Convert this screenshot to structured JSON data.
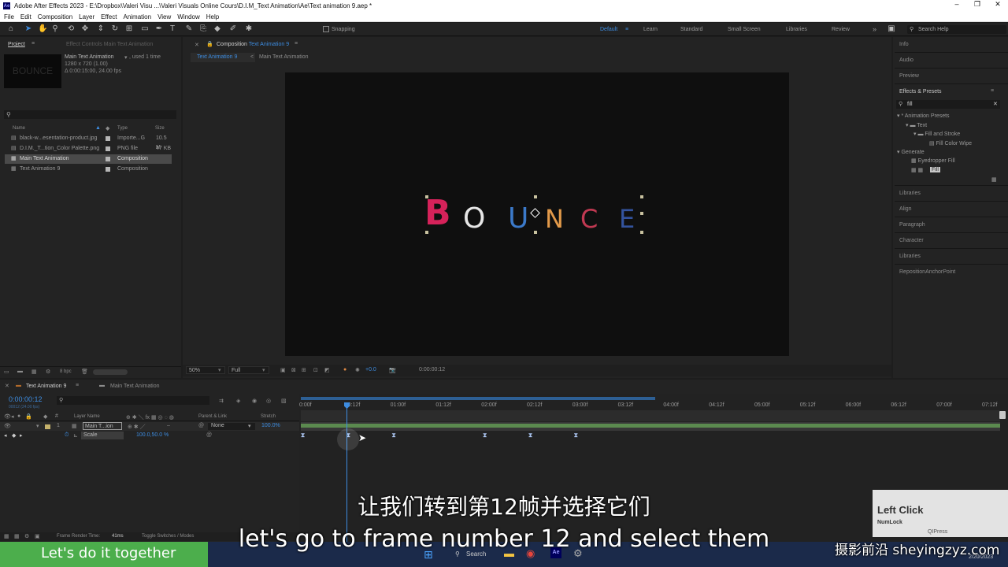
{
  "window": {
    "title": "Adobe After Effects 2023 - E:\\Dropbox\\Valeri Visu ...\\Valeri Visuals Online Cours\\D.I.M_Text Animation\\Ae\\Text animation 9.aep *",
    "app_icon": "Ae",
    "minimize": "–",
    "maximize": "❐",
    "close": "✕"
  },
  "menu": [
    "File",
    "Edit",
    "Composition",
    "Layer",
    "Effect",
    "Animation",
    "View",
    "Window",
    "Help"
  ],
  "toolbar": {
    "snapping": "Snapping",
    "workspaces": [
      "Default",
      "Learn",
      "Standard",
      "Small Screen",
      "Libraries",
      "Review"
    ],
    "more": "»",
    "search_placeholder": "Search Help"
  },
  "project": {
    "tab": "Project",
    "effect_controls_tab": "Effect Controls Main Text Animation",
    "selected_name": "Main Text Animation",
    "used": ", used 1 time",
    "dims": "1280 x 720 (1.00)",
    "duration": "Δ 0:00:15:00, 24.00 fps",
    "thumb_text": "BOUNCE",
    "columns": {
      "name": "Name",
      "type": "Type",
      "size": "Size"
    },
    "items": [
      {
        "name": "black-w...esentation-product.jpg",
        "type": "Importe...G",
        "size": "10.5 M"
      },
      {
        "name": "D.I.M._T...tion_Color Palette.png",
        "type": "PNG file",
        "size": "47 KB"
      },
      {
        "name": "Main Text Animation",
        "type": "Composition",
        "size": ""
      },
      {
        "name": "Text Animation 9",
        "type": "Composition",
        "size": ""
      }
    ],
    "bpc": "8 bpc"
  },
  "composition": {
    "tab": "Composition Text Animation 9",
    "tab_prefix": "Composition",
    "tab_name": "Text Animation 9",
    "breadcrumbs": [
      "Text Animation 9",
      "Main Text Animation"
    ],
    "letters": [
      {
        "ch": "B",
        "color": "#d6225a"
      },
      {
        "ch": "O",
        "color": "#e6e6e6"
      },
      {
        "ch": "U",
        "color": "#3b79c9"
      },
      {
        "ch": "N",
        "color": "#e39a4a"
      },
      {
        "ch": "C",
        "color": "#c13952"
      },
      {
        "ch": "E",
        "color": "#33539e"
      }
    ],
    "zoom": "50%",
    "resolution": "Full",
    "exposure": "+0.0",
    "timecode": "0:00:00:12"
  },
  "right_panel": {
    "top_tabs": [
      "Info",
      "Audio",
      "Preview"
    ],
    "effects_presets": {
      "title": "Effects & Presets",
      "search_value": "fill",
      "tree": [
        {
          "label": "* Animation Presets",
          "depth": 0
        },
        {
          "label": "Text",
          "depth": 1
        },
        {
          "label": "Fill and Stroke",
          "depth": 2
        },
        {
          "label": "Fill Color Wipe",
          "depth": 3
        },
        {
          "label": "Generate",
          "depth": 0
        },
        {
          "label": "Eyedropper Fill",
          "depth": 1
        },
        {
          "label": "Fill",
          "depth": 1
        }
      ]
    },
    "bottom_tabs": [
      "Libraries",
      "Align",
      "Paragraph",
      "Character",
      "Libraries",
      "RepositionAnchorPoint"
    ]
  },
  "timeline": {
    "tabs": [
      "Text Animation 9",
      "Main Text Animation"
    ],
    "timecode": "0:00:00:12",
    "timecode_sub": "00012 (24.00 fps)",
    "columns": {
      "layer_name": "Layer Name",
      "parent": "Parent & Link",
      "stretch": "Stretch"
    },
    "layer": {
      "index": "1",
      "name": "Main T...ion",
      "parent": "None",
      "stretch": "100.0%"
    },
    "property": {
      "name": "Scale",
      "value": "100.0,50.0 %"
    },
    "ticks": [
      "0:00f",
      "00:12f",
      "01:00f",
      "01:12f",
      "02:00f",
      "02:12f",
      "03:00f",
      "03:12f",
      "04:00f",
      "04:12f",
      "05:00f",
      "05:12f",
      "06:00f",
      "06:12f",
      "07:00f",
      "07:12f"
    ],
    "keyframes_frames": [
      0,
      12,
      24,
      48,
      60,
      72
    ],
    "playhead_frame": 12,
    "render_label": "Frame Render Time:",
    "render_value": "41ms",
    "toggle": "Toggle Switches / Modes"
  },
  "overlay": {
    "left_click": "Left Click",
    "numlock": "NumLock",
    "qipress": "QIPress",
    "date": "2/20/2023",
    "banner": "Let's do it together",
    "taskbar_search": "Search",
    "subtitle_cn": "让我们转到第12帧并选择它们",
    "subtitle_en": "let's go to frame number 12 and select them",
    "watermark": "摄影前沿 sheyingzyz.com"
  }
}
